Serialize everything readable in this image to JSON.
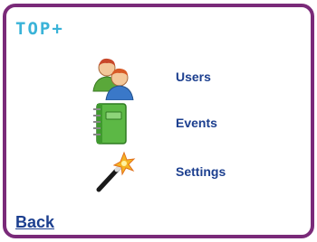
{
  "header": {
    "brand": "TOP+"
  },
  "menu": {
    "items": [
      {
        "label": "Users",
        "icon": "users-icon"
      },
      {
        "label": "Events",
        "icon": "notebook-icon"
      },
      {
        "label": "Settings",
        "icon": "magic-wand-icon"
      }
    ]
  },
  "footer": {
    "back_label": "Back"
  },
  "colors": {
    "frame": "#7a2a79",
    "brand": "#3ab3d8",
    "label": "#1c3f8f"
  }
}
